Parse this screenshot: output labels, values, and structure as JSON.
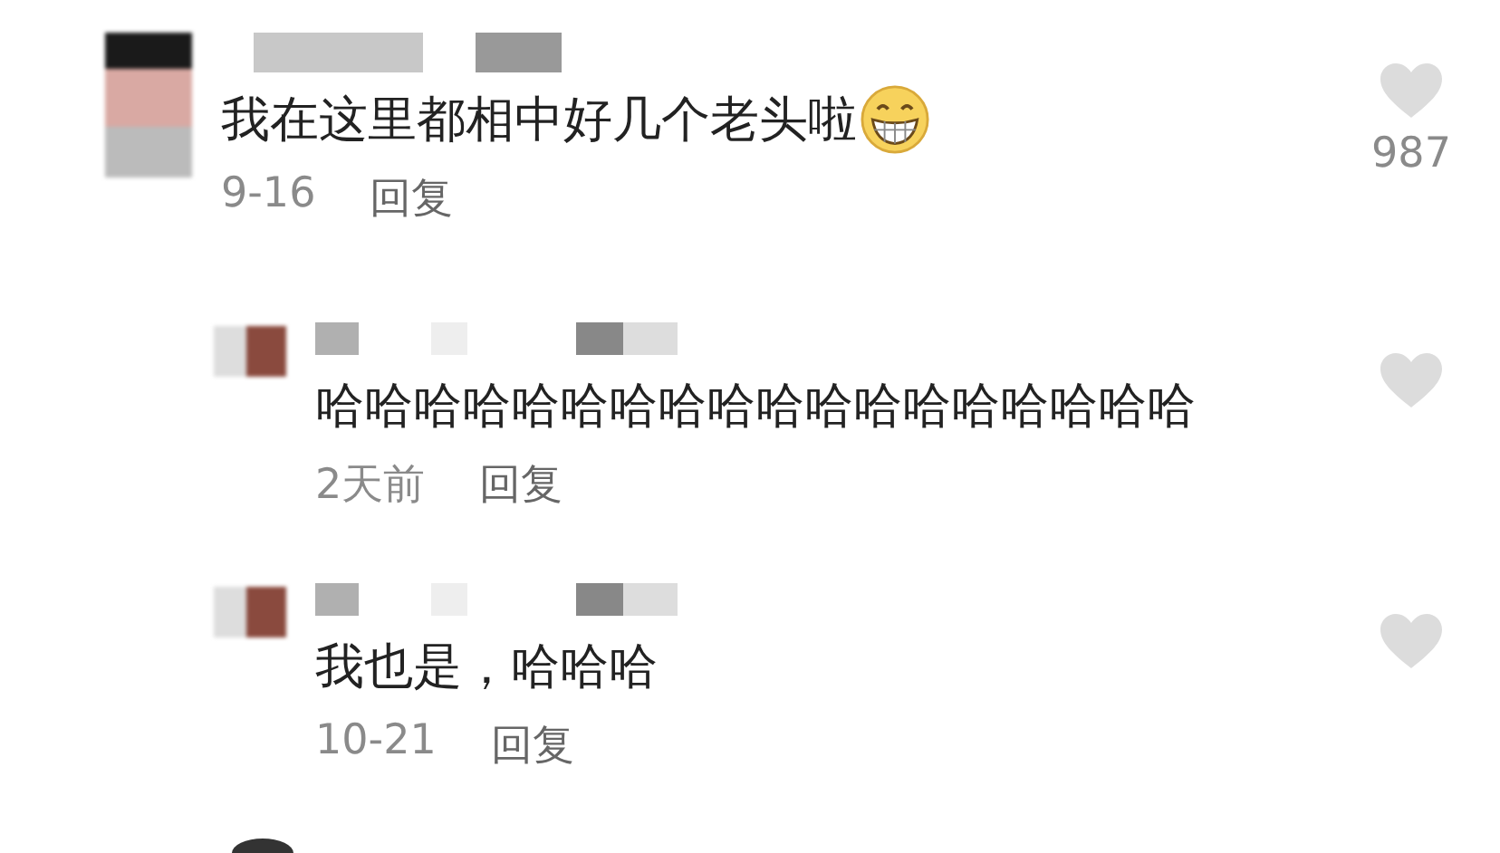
{
  "comments": [
    {
      "text": "我在这里都相中好几个老头啦",
      "has_emoji": true,
      "date": "9-16",
      "reply_label": "回复",
      "liked": false,
      "likes": "987",
      "children": [
        {
          "text": "哈哈哈哈哈哈哈哈哈哈哈哈哈哈哈哈哈哈",
          "date": "2天前",
          "reply_label": "回复",
          "liked": false
        },
        {
          "text": "我也是，哈哈哈",
          "date": "10-21",
          "reply_label": "回复",
          "liked": false
        }
      ]
    }
  ]
}
